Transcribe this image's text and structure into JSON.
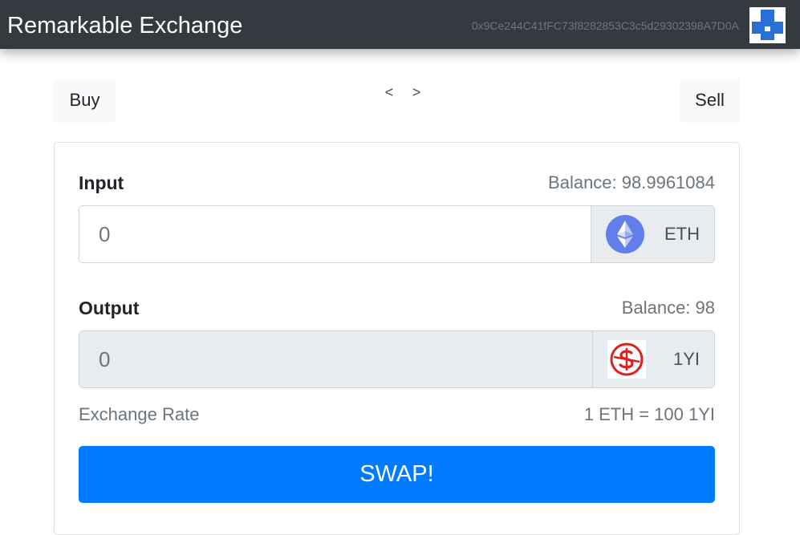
{
  "navbar": {
    "brand": "Remarkable Exchange",
    "address": "0x9Ce244C41fFC73f8282853C3c5d29302398A7D0A"
  },
  "tabs": {
    "buy_label": "Buy",
    "sell_label": "Sell",
    "prev_label": "<",
    "next_label": ">"
  },
  "input": {
    "label": "Input",
    "balance": "Balance: 98.9961084",
    "value": "0",
    "token": "ETH",
    "token_icon": "ethereum-icon"
  },
  "output": {
    "label": "Output",
    "balance": "Balance: 98",
    "value": "0",
    "token": "1YI",
    "token_icon": "1yi-token-icon"
  },
  "exchange_rate": {
    "label": "Exchange Rate",
    "value": "1 ETH = 100 1YI"
  },
  "swap_label": "SWAP!",
  "colors": {
    "navbar": "#343a40",
    "primary": "#007bff",
    "ethereum": "#627eea",
    "token_red": "#e02020"
  }
}
